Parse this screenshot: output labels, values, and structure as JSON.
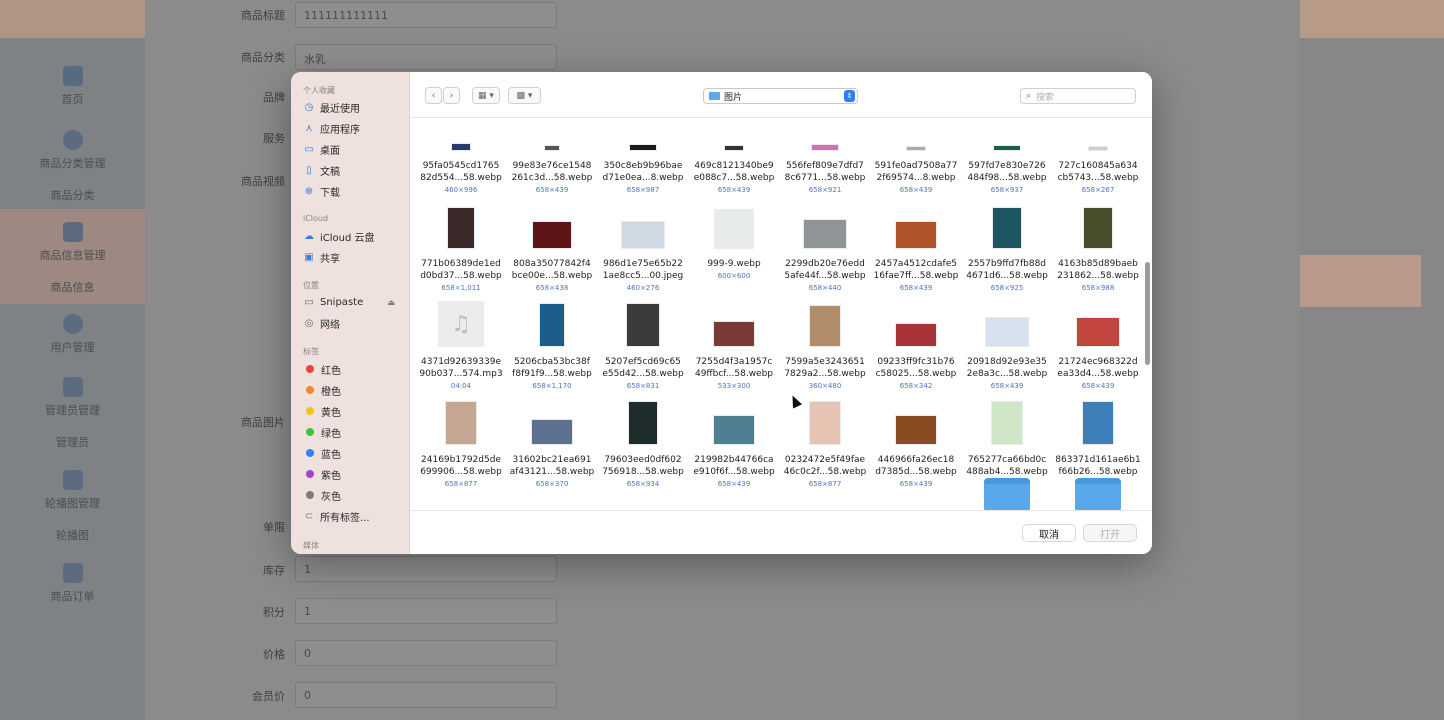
{
  "background": {
    "nav": [
      {
        "label": "首页",
        "sub": ""
      },
      {
        "label": "商品分类管理",
        "sub": "商品分类"
      },
      {
        "label": "商品信息管理",
        "sub": "商品信息"
      },
      {
        "label": "用户管理",
        "sub": ""
      },
      {
        "label": "管理员管理",
        "sub": "管理员"
      },
      {
        "label": "轮播图管理",
        "sub": "轮播图"
      },
      {
        "label": "商品订单",
        "sub": ""
      }
    ],
    "form": {
      "title_label": "商品标题",
      "title_value": "111111111111",
      "category_label": "商品分类",
      "category_value": "水乳",
      "brand_label": "品牌",
      "service_label": "服务",
      "video_label": "商品视频",
      "image_label": "商品图片",
      "limit_label": "单限",
      "stock_label": "库存",
      "stock_value": "1",
      "points_label": "积分",
      "points_value": "1",
      "price_label": "价格",
      "price_value": "0",
      "member_price_label": "会员价",
      "member_price_value": "0"
    }
  },
  "dialog": {
    "sidebar": {
      "favorites_heading": "个人收藏",
      "favorites": [
        {
          "label": "最近使用",
          "icon": "clock-icon"
        },
        {
          "label": "应用程序",
          "icon": "apps-icon"
        },
        {
          "label": "桌面",
          "icon": "desktop-icon"
        },
        {
          "label": "文稿",
          "icon": "document-icon"
        },
        {
          "label": "下载",
          "icon": "download-icon"
        }
      ],
      "icloud_heading": "iCloud",
      "icloud": [
        {
          "label": "iCloud 云盘",
          "icon": "cloud-icon"
        },
        {
          "label": "共享",
          "icon": "shared-folder-icon"
        }
      ],
      "locations_heading": "位置",
      "locations": [
        {
          "label": "Snipaste",
          "icon": "drive-icon"
        },
        {
          "label": "网络",
          "icon": "network-icon"
        }
      ],
      "tags_heading": "标签",
      "tags": [
        {
          "label": "红色",
          "color": "#e8463c"
        },
        {
          "label": "橙色",
          "color": "#f08a24"
        },
        {
          "label": "黄色",
          "color": "#f3c318"
        },
        {
          "label": "绿色",
          "color": "#3ec33b"
        },
        {
          "label": "蓝色",
          "color": "#2f83f2"
        },
        {
          "label": "紫色",
          "color": "#a345c9"
        },
        {
          "label": "灰色",
          "color": "#8a8a8a"
        }
      ],
      "all_tags": "所有标签...",
      "media_heading": "媒体"
    },
    "toolbar": {
      "location": "图片",
      "search_placeholder": "搜索"
    },
    "files": [
      {
        "name1": "95fa0545cd1765",
        "name2": "82d554...58.webp",
        "size": "460×996"
      },
      {
        "name1": "99e83e76ce1548",
        "name2": "261c3d...58.webp",
        "size": "658×439"
      },
      {
        "name1": "350c8eb9b96bae",
        "name2": "d71e0ea...8.webp",
        "size": "658×987"
      },
      {
        "name1": "469c8121340be9",
        "name2": "e088c7...58.webp",
        "size": "658×439"
      },
      {
        "name1": "556fef809e7dfd7",
        "name2": "8c6771...58.webp",
        "size": "658×921"
      },
      {
        "name1": "591fe0ad7508a77",
        "name2": "2f69574...8.webp",
        "size": "658×439"
      },
      {
        "name1": "597fd7e830e726",
        "name2": "484f98...58.webp",
        "size": "658×937"
      },
      {
        "name1": "727c160845a634",
        "name2": "cb5743...58.webp",
        "size": "658×267"
      },
      {
        "name1": "771b06389de1ed",
        "name2": "d0bd37...58.webp",
        "size": "658×1,011"
      },
      {
        "name1": "808a35077842f4",
        "name2": "bce00e...58.webp",
        "size": "658×438"
      },
      {
        "name1": "986d1e75e65b22",
        "name2": "1ae8cc5...00.jpeg",
        "size": "460×276"
      },
      {
        "name1": "999-9.webp",
        "name2": "",
        "size": "600×600"
      },
      {
        "name1": "2299db20e76edd",
        "name2": "5afe44f...58.webp",
        "size": "658×440"
      },
      {
        "name1": "2457a4512cdafe5",
        "name2": "16fae7ff...58.webp",
        "size": "658×439"
      },
      {
        "name1": "2557b9ffd7fb88d",
        "name2": "4671d6...58.webp",
        "size": "658×925"
      },
      {
        "name1": "4163b85d89baeb",
        "name2": "231862...58.webp",
        "size": "658×988"
      },
      {
        "name1": "4371d92639339e",
        "name2": "90b037...574.mp3",
        "size": "04:04"
      },
      {
        "name1": "5206cba53bc38f",
        "name2": "f8f91f9...58.webp",
        "size": "658×1,170"
      },
      {
        "name1": "5207ef5cd69c65",
        "name2": "e55d42...58.webp",
        "size": "658×831"
      },
      {
        "name1": "7255d4f3a1957c",
        "name2": "49ffbcf...58.webp",
        "size": "533×300"
      },
      {
        "name1": "7599a5e3243651",
        "name2": "7829a2...58.webp",
        "size": "360×480"
      },
      {
        "name1": "09233ff9fc31b76",
        "name2": "c58025...58.webp",
        "size": "658×342"
      },
      {
        "name1": "20918d92e93e35",
        "name2": "2e8a3c...58.webp",
        "size": "658×439"
      },
      {
        "name1": "21724ec968322d",
        "name2": "ea33d4...58.webp",
        "size": "658×439"
      },
      {
        "name1": "24169b1792d5de",
        "name2": "699906...58.webp",
        "size": "658×877"
      },
      {
        "name1": "31602bc21ea691",
        "name2": "af43121...58.webp",
        "size": "658×370"
      },
      {
        "name1": "79603eed0df602",
        "name2": "756918...58.webp",
        "size": "658×934"
      },
      {
        "name1": "219982b44766ca",
        "name2": "e910f6f...58.webp",
        "size": "658×439"
      },
      {
        "name1": "0232472e5f49fae",
        "name2": "46c0c2f...58.webp",
        "size": "658×877"
      },
      {
        "name1": "446966fa26ec18",
        "name2": "d7385d...58.webp",
        "size": "658×439"
      },
      {
        "name1": "765277ca66bd0c",
        "name2": "488ab4...58.webp",
        "size": "658×877"
      },
      {
        "name1": "863371d161ae6b1",
        "name2": "f66b26...58.webp",
        "size": "658×877"
      }
    ],
    "footer": {
      "cancel": "取消",
      "open": "打开"
    }
  }
}
